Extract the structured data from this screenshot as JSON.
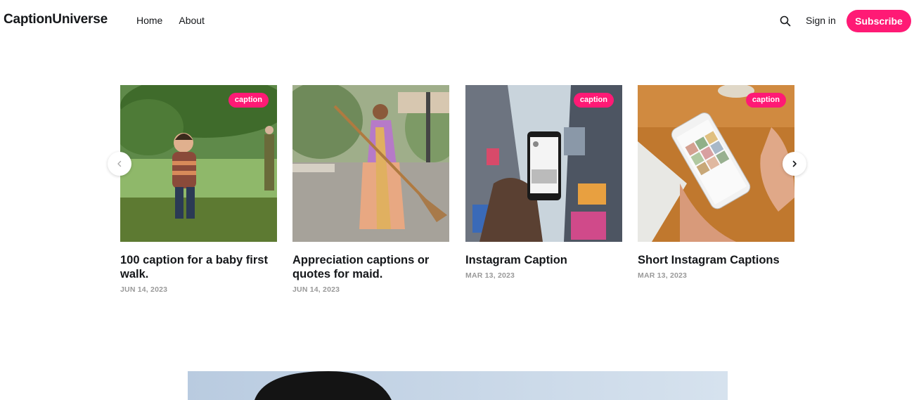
{
  "header": {
    "logo": "CaptionUniverse",
    "nav": [
      {
        "label": "Home"
      },
      {
        "label": "About"
      }
    ],
    "search_icon": "search-icon",
    "signin_label": "Sign in",
    "subscribe_label": "Subscribe"
  },
  "colors": {
    "accent": "#ff1a75",
    "text": "#15171a",
    "muted": "#999999"
  },
  "carousel": {
    "prev_icon": "chevron-left-icon",
    "next_icon": "chevron-right-icon",
    "cards": [
      {
        "tag": "caption",
        "title": "100 caption for a baby first walk.",
        "date": "JUN 14, 2023",
        "image": "baby-walking-in-park"
      },
      {
        "tag": "",
        "title": "Appreciation captions or quotes for maid.",
        "date": "JUN 14, 2023",
        "image": "woman-sweeping-street"
      },
      {
        "tag": "caption",
        "title": "Instagram Caption",
        "date": "MAR 13, 2023",
        "image": "phone-in-city"
      },
      {
        "tag": "caption",
        "title": "Short Instagram Captions",
        "date": "MAR 13, 2023",
        "image": "phone-instagram-grid"
      }
    ]
  },
  "featured": {
    "image": "person-portrait-sky"
  }
}
